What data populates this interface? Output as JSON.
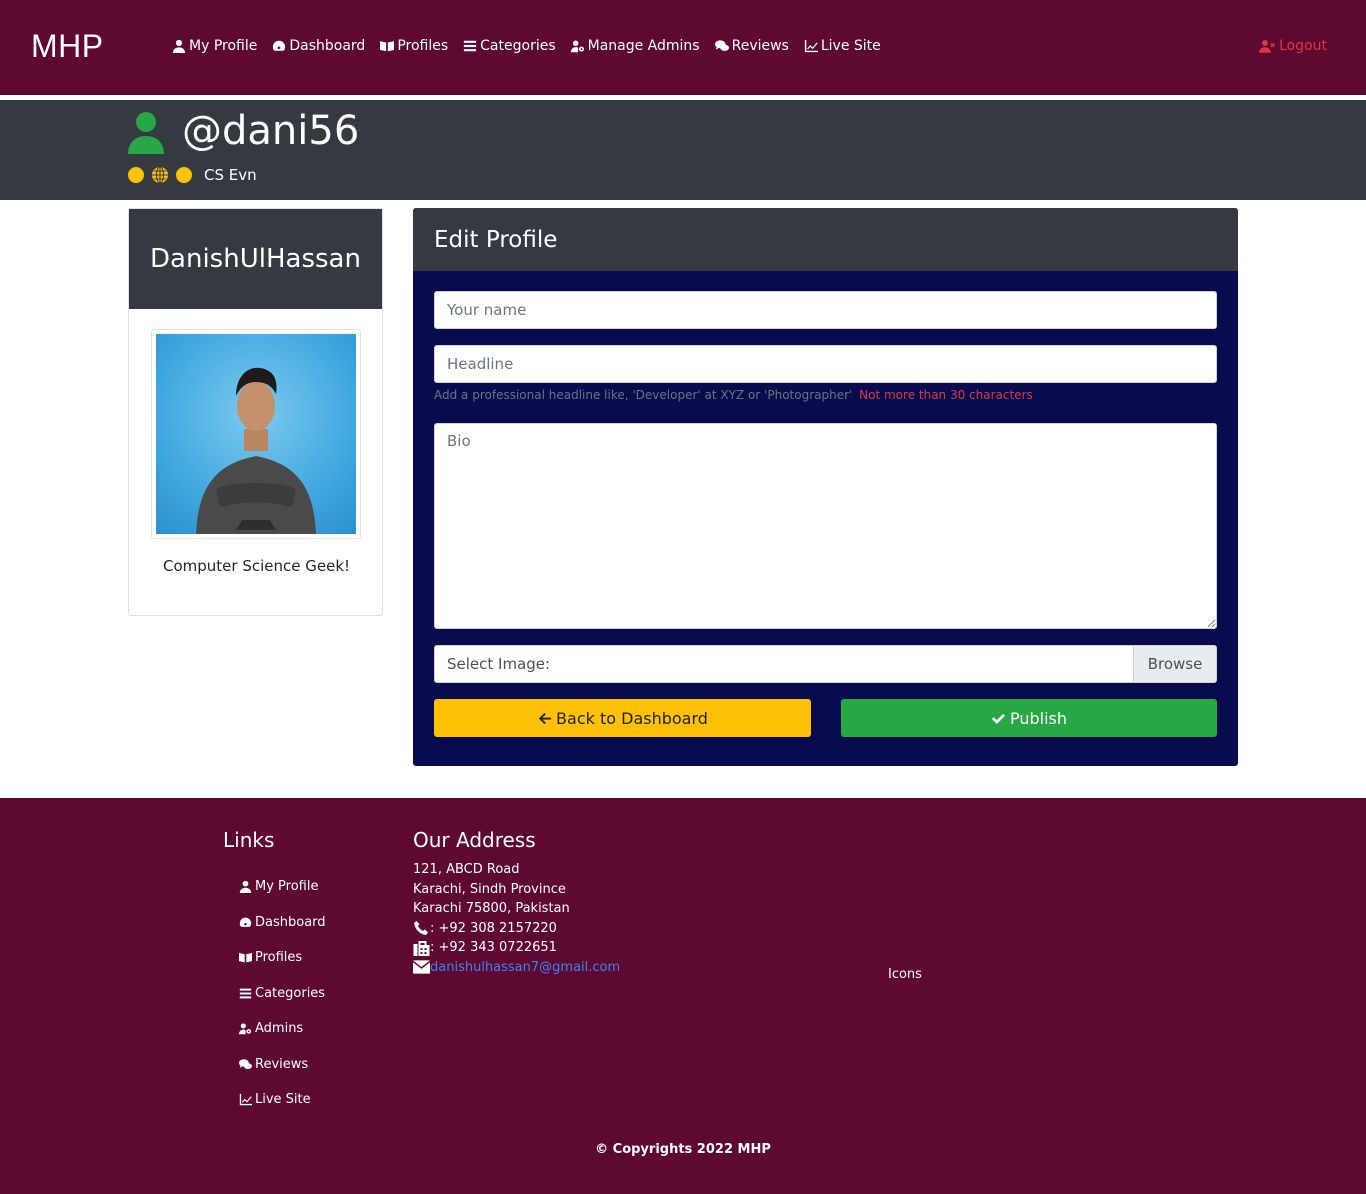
{
  "nav": {
    "brand": "MHP",
    "items": [
      {
        "label": "My Profile",
        "icon": "user-icon"
      },
      {
        "label": "Dashboard",
        "icon": "dashboard-icon"
      },
      {
        "label": "Profiles",
        "icon": "book-open-icon"
      },
      {
        "label": "Categories",
        "icon": "list-icon"
      },
      {
        "label": "Manage Admins",
        "icon": "user-cog-icon"
      },
      {
        "label": "Reviews",
        "icon": "comments-icon"
      },
      {
        "label": "Live Site",
        "icon": "chart-line-icon"
      }
    ],
    "logout": "Logout"
  },
  "header": {
    "username": "@dani56",
    "tagline": "CS Evn"
  },
  "profile_card": {
    "name": "DanishUlHassan",
    "bio": "Computer Science Geek!"
  },
  "edit": {
    "title": "Edit Profile",
    "name_placeholder": "Your name",
    "headline_placeholder": "Headline",
    "headline_help": "Add a professional headline like, 'Developer' at XYZ or 'Photographer'",
    "headline_warning": "Not more than 30 characters",
    "bio_placeholder": "Bio",
    "image_label": "Select Image:",
    "browse": "Browse",
    "back_button": "Back to Dashboard",
    "publish_button": "Publish"
  },
  "footer": {
    "links_title": "Links",
    "links": [
      "My Profile",
      "Dashboard",
      "Profiles",
      "Categories",
      "Admins",
      "Reviews",
      "Live Site"
    ],
    "address_title": "Our Address",
    "address_lines": [
      "121, ABCD Road",
      "Karachi, Sindh Province",
      "Karachi 75800, Pakistan"
    ],
    "phone": ": +92 308 2157220",
    "fax": ": +92 343 0722651",
    "email": "danishulhassan7@gmail.com",
    "icons_label": "Icons",
    "copyright": "© Copyrights 2022 MHP"
  },
  "colors": {
    "brand": "#5e0a30",
    "dark": "#343a40",
    "form_bg": "#090b4f",
    "warning": "#ffc107",
    "success": "#28a745",
    "danger": "#dc3545"
  }
}
